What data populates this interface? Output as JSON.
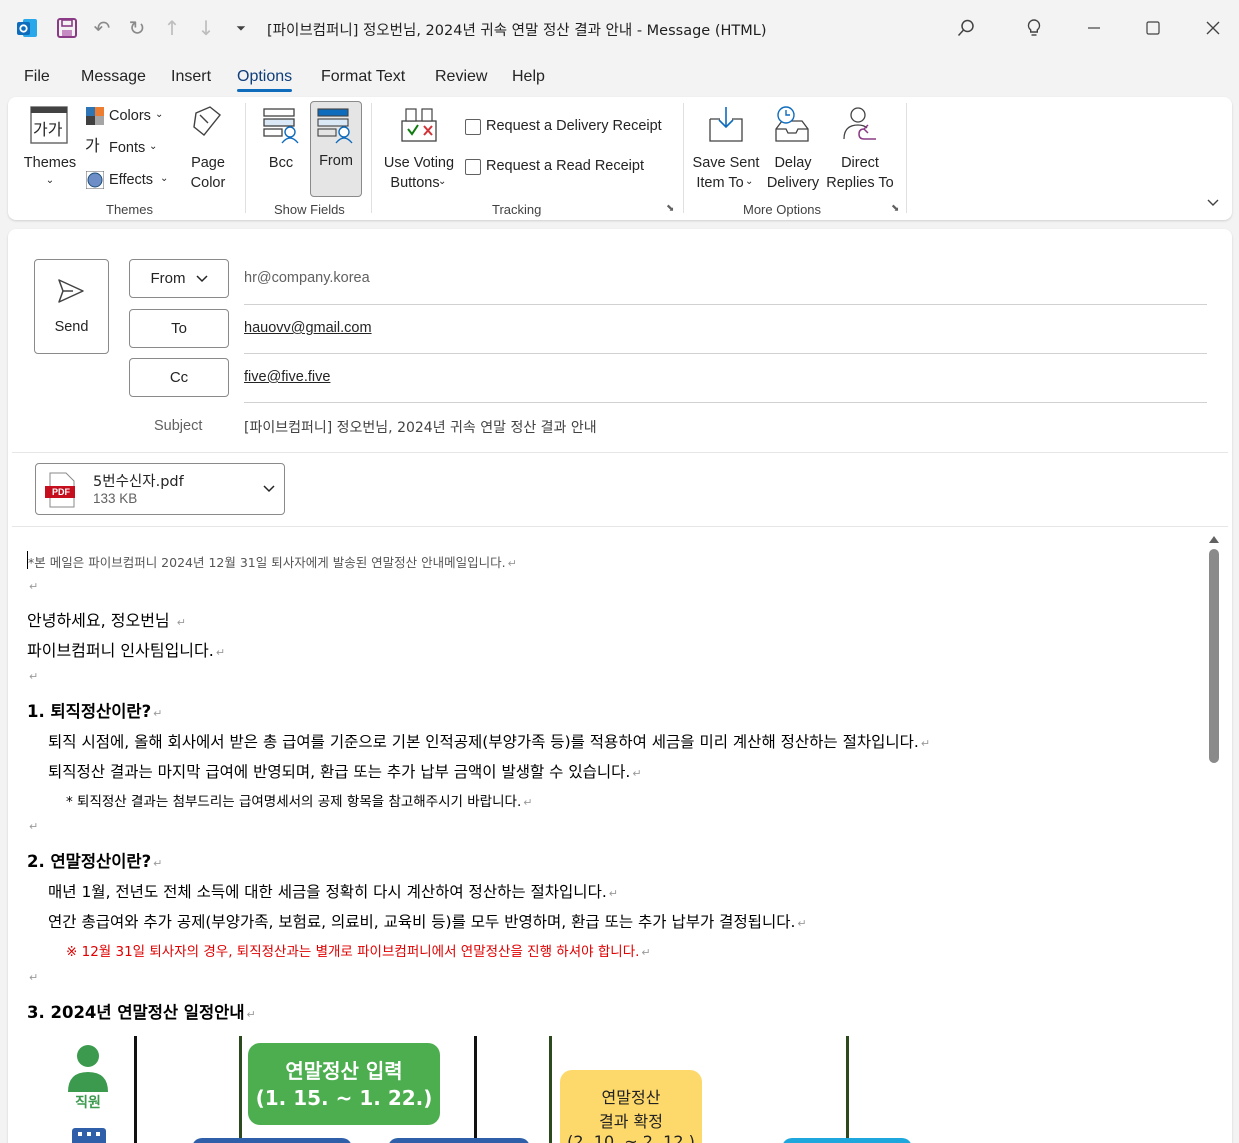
{
  "window": {
    "title": "[파이브컴퍼니] 정오번님, 2024년 귀속 연말 정산 결과 안내  -  Message (HTML)"
  },
  "menu": {
    "tabs": [
      "File",
      "Message",
      "Insert",
      "Options",
      "Format Text",
      "Review",
      "Help"
    ],
    "active": "Options"
  },
  "ribbon": {
    "themes": {
      "themes_label": "Themes",
      "colors_label": "Colors",
      "fonts_label": "Fonts",
      "effects_label": "Effects",
      "page_color_line1": "Page",
      "page_color_line2": "Color",
      "group_label": "Themes",
      "themes_icon_text": "가가",
      "fonts_icon_text": "가"
    },
    "show_fields": {
      "bcc_label": "Bcc",
      "from_label": "From",
      "group_label": "Show Fields"
    },
    "tracking": {
      "voting_line1": "Use Voting",
      "voting_line2": "Buttons",
      "delivery_receipt": "Request a Delivery Receipt",
      "read_receipt": "Request a Read Receipt",
      "group_label": "Tracking"
    },
    "more_options": {
      "save_sent_line1": "Save Sent",
      "save_sent_line2": "Item To",
      "delay_line1": "Delay",
      "delay_line2": "Delivery",
      "direct_line1": "Direct",
      "direct_line2": "Replies To",
      "group_label": "More Options"
    }
  },
  "compose": {
    "send_label": "Send",
    "from_button": "From",
    "from_value": "hr@company.korea",
    "to_button": "To",
    "to_value": "hauovv@gmail.com",
    "cc_button": "Cc",
    "cc_value": "five@five.five",
    "subject_label": "Subject",
    "subject_value": "[파이브컴퍼니] 정오번님, 2024년 귀속 연말 정산 결과 안내",
    "attachment": {
      "name": "5번수신자.pdf",
      "size": "133 KB",
      "type_badge": "PDF"
    }
  },
  "body": {
    "notice": "*본 메일은 파이브컴퍼니 2024년 12월 31일 퇴사자에게 발송된 연말정산 안내메일입니다.",
    "greeting": "안녕하세요, 정오번님 ",
    "team": "파이브컴퍼니 인사팀입니다.",
    "s1_title": "1. 퇴직정산이란?",
    "s1_line1": "퇴직 시점에, 올해 회사에서 받은 총 급여를 기준으로 기본 인적공제(부양가족 등)를 적용하여 세금을 미리 계산해 정산하는 절차입니다.",
    "s1_line2": "퇴직정산 결과는 마지막 급여에 반영되며, 환급 또는 추가 납부 금액이 발생할 수 있습니다.",
    "s1_note": "* 퇴직정산 결과는 첨부드리는 급여명세서의 공제 항목을 참고해주시기 바랍니다.",
    "s2_title": "2. 연말정산이란?",
    "s2_line1": "매년 1월, 전년도 전체 소득에 대한 세금을 정확히 다시 계산하여 정산하는 절차입니다.",
    "s2_line2": "연간 총급여와 추가 공제(부양가족, 보험료, 의료비, 교육비 등)를 모두 반영하며, 환급 또는 추가 납부가 결정됩니다.",
    "s2_warning": "※ 12월 31일 퇴사자의 경우, 퇴직정산과는 별개로 파이브컴퍼니에서 연말정산을 진행 하셔야 합니다.",
    "s3_title": "3. 2024년 연말정산 일정안내",
    "pilcrow": "↵",
    "diagram": {
      "employee_label": "직원",
      "box1_line1": "연말정산 입력",
      "box1_line2": "(1. 15. ~ 1. 22.)",
      "box2_line1": "연말정산",
      "box2_line2": "결과 확정",
      "box2_line3": "(2. 10. ~ 2. 12.)"
    }
  },
  "colors": {
    "accent": "#0f6cbd",
    "green_box": "#4cae4f",
    "yellow_box": "#fdd86a",
    "warning_red": "#e00000"
  }
}
